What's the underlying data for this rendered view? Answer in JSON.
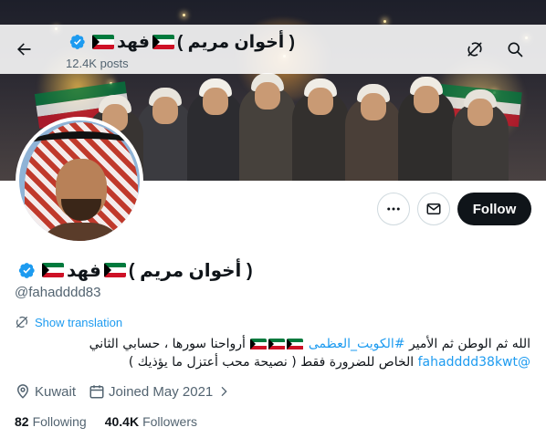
{
  "header": {
    "name_prefix": "( أخوان مريم )",
    "name_word": "فهد",
    "posts": "12.4K posts",
    "icons": [
      "back-arrow-icon",
      "grok-icon",
      "search-icon"
    ]
  },
  "profile": {
    "name_prefix": "( أخوان مريم )",
    "name_word": "فهد",
    "handle": "@fahadddd83",
    "verified": true,
    "translate_label": "Show translation",
    "follow_label": "Follow",
    "more_icon": "more-icon",
    "message_icon": "envelope-icon",
    "bio": {
      "line1_text": "الله ثم الوطن ثم الأمير",
      "line1_hashtag": "#الكويت_العظمى",
      "line1_tail": "أرواحنا سورها ، حسابي الثاني",
      "line2_mention": "@fahadddd38kwt",
      "line2_text": "الخاص للضرورة فقط ( نصيحة محب أعتزل ما يؤذيك )"
    },
    "location": "Kuwait",
    "joined": "Joined May 2021",
    "following_count": "82",
    "following_label": "Following",
    "followers_count": "40.4K",
    "followers_label": "Followers"
  },
  "colors": {
    "accent": "#1d9bf0",
    "text": "#0f1419",
    "muted": "#536471",
    "follow_button": "#0f1419",
    "kuwait_flag": [
      "#007a3d",
      "#ffffff",
      "#ce1126",
      "#000000"
    ]
  }
}
